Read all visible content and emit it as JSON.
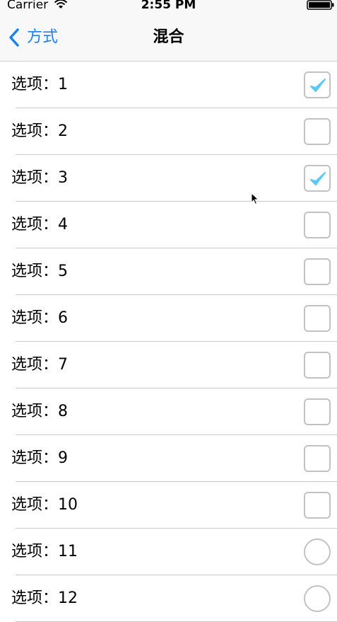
{
  "status_bar": {
    "carrier": "Carrier",
    "time": "2:55 PM",
    "wifi_icon": "wifi-icon",
    "battery_icon": "battery-icon"
  },
  "nav": {
    "back_label": "方式",
    "title": "混合"
  },
  "colors": {
    "accent": "#1a82f2",
    "check": "#5ac8fa",
    "border": "#c2c2c2",
    "separator": "#c9c9cd"
  },
  "rows": [
    {
      "label": "选项：1",
      "control": "checkbox",
      "checked": true
    },
    {
      "label": "选项：2",
      "control": "checkbox",
      "checked": false
    },
    {
      "label": "选项：3",
      "control": "checkbox",
      "checked": true
    },
    {
      "label": "选项：4",
      "control": "checkbox",
      "checked": false
    },
    {
      "label": "选项：5",
      "control": "checkbox",
      "checked": false
    },
    {
      "label": "选项：6",
      "control": "checkbox",
      "checked": false
    },
    {
      "label": "选项：7",
      "control": "checkbox",
      "checked": false
    },
    {
      "label": "选项：8",
      "control": "checkbox",
      "checked": false
    },
    {
      "label": "选项：9",
      "control": "checkbox",
      "checked": false
    },
    {
      "label": "选项：10",
      "control": "checkbox",
      "checked": false
    },
    {
      "label": "选项：11",
      "control": "radio",
      "checked": false
    },
    {
      "label": "选项：12",
      "control": "radio",
      "checked": false
    }
  ]
}
